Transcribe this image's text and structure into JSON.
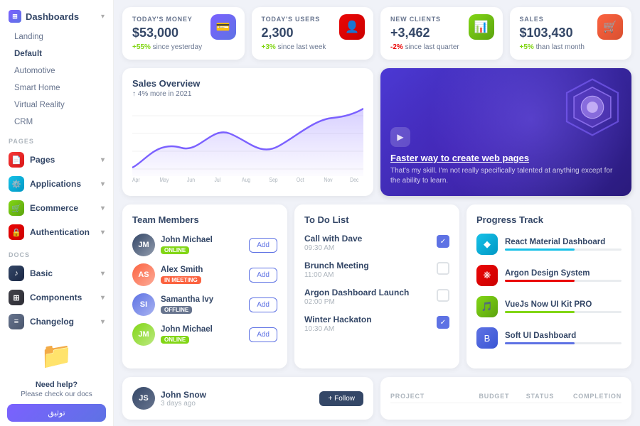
{
  "sidebar": {
    "brand": "Dashboards",
    "brand_chevron": "▾",
    "nav_items": [
      {
        "label": "Landing",
        "active": false
      },
      {
        "label": "Default",
        "active": true
      },
      {
        "label": "Automotive",
        "active": false
      },
      {
        "label": "Smart Home",
        "active": false
      },
      {
        "label": "Virtual Reality",
        "active": false
      },
      {
        "label": "CRM",
        "active": false
      }
    ],
    "pages_section": "PAGES",
    "pages_items": [
      {
        "label": "Pages",
        "icon": "📄",
        "icon_class": "icon-orange"
      },
      {
        "label": "Applications",
        "icon": "⚙️",
        "icon_class": "icon-blue"
      },
      {
        "label": "Ecommerce",
        "icon": "🛒",
        "icon_class": "icon-green"
      },
      {
        "label": "Authentication",
        "icon": "🔒",
        "icon_class": "icon-red"
      }
    ],
    "docs_section": "DOCS",
    "docs_items": [
      {
        "label": "Basic",
        "icon": "♪",
        "icon_class": "icon-music"
      },
      {
        "label": "Components",
        "icon": "⊞",
        "icon_class": "icon-comp"
      },
      {
        "label": "Changelog",
        "icon": "≡",
        "icon_class": "icon-log"
      }
    ],
    "help_title": "Need help?",
    "help_subtitle": "Please check our docs",
    "help_btn": "توثيق"
  },
  "stats": [
    {
      "label": "TODAY'S MONEY",
      "value": "$53,000",
      "change": "+55%",
      "change_dir": "up",
      "change_text": " since yesterday",
      "icon": "💳",
      "icon_class": "stat-icon-purple"
    },
    {
      "label": "TODAY'S USERS",
      "value": "2,300",
      "change": "+3%",
      "change_dir": "up",
      "change_text": " since last week",
      "icon": "👤",
      "icon_class": "stat-icon-red"
    },
    {
      "label": "NEW CLIENTS",
      "value": "+3,462",
      "change": "-2%",
      "change_dir": "down",
      "change_text": " since last quarter",
      "icon": "📊",
      "icon_class": "stat-icon-green"
    },
    {
      "label": "SALES",
      "value": "$103,430",
      "change": "+5%",
      "change_dir": "up",
      "change_text": " than last month",
      "icon": "🛒",
      "icon_class": "stat-icon-orange"
    }
  ],
  "chart": {
    "title": "Sales Overview",
    "subtitle": "↑ 4% more",
    "subtitle_rest": " in 2021",
    "months": [
      "Apr",
      "May",
      "Jun",
      "Jul",
      "Aug",
      "Sep",
      "Oct",
      "Nov",
      "Dec"
    ],
    "data_points": [
      20,
      45,
      28,
      60,
      35,
      55,
      45,
      65,
      80
    ]
  },
  "promo": {
    "title": "Faster way to create web pages",
    "description": "That's my skill. I'm not really specifically talented at anything except for the ability to learn."
  },
  "team": {
    "title": "Team Members",
    "members": [
      {
        "name": "John Michael",
        "status": "ONLINE",
        "badge_class": "badge-online",
        "color": "#344767"
      },
      {
        "name": "Alex Smith",
        "status": "IN MEETING",
        "badge_class": "badge-meeting",
        "color": "#fb6340"
      },
      {
        "name": "Samantha Ivy",
        "status": "OFFLINE",
        "badge_class": "badge-offline",
        "color": "#5e72e4"
      },
      {
        "name": "John Michael",
        "status": "ONLINE",
        "badge_class": "badge-online",
        "color": "#82d616"
      }
    ],
    "add_label": "Add"
  },
  "todo": {
    "title": "To Do List",
    "items": [
      {
        "task": "Call with Dave",
        "time": "09:30 AM",
        "checked": true
      },
      {
        "task": "Brunch Meeting",
        "time": "11:00 AM",
        "checked": false
      },
      {
        "task": "Argon Dashboard Launch",
        "time": "02:00 PM",
        "checked": false
      },
      {
        "task": "Winter Hackaton",
        "time": "10:30 AM",
        "checked": true
      }
    ]
  },
  "progress": {
    "title": "Progress Track",
    "items": [
      {
        "name": "React Material Dashboard",
        "color": "#17c1e8",
        "logo_class": "logo-blue",
        "logo_char": "◆"
      },
      {
        "name": "Argon Design System",
        "color": "#ea0606",
        "logo_class": "logo-red",
        "logo_char": "❋"
      },
      {
        "name": "VueJs Now UI Kit PRO",
        "color": "#82d616",
        "logo_class": "logo-green",
        "logo_char": "🎵"
      },
      {
        "name": "Soft UI Dashboard",
        "color": "#5e72e4",
        "logo_class": "logo-indigo",
        "logo_char": "B"
      }
    ]
  },
  "footer_author": {
    "name": "John Snow",
    "time": "3 days ago",
    "follow_label": "+ Follow"
  },
  "footer_table": {
    "headers": [
      "PROJECT",
      "BUDGET",
      "STATUS",
      "COMPLETION"
    ]
  }
}
